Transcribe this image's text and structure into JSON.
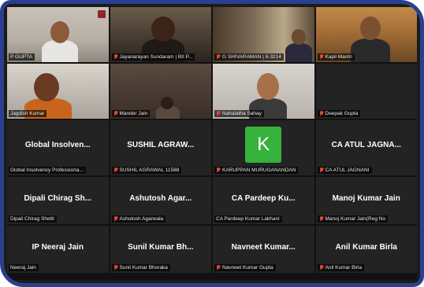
{
  "participants": [
    {
      "name": "P GUPTA",
      "muted": false,
      "kind": "video"
    },
    {
      "name": "Jayanarayan Sundaram | BII P...",
      "muted": true,
      "kind": "video"
    },
    {
      "name": "G SHIVARAMAN | 8-3214",
      "muted": true,
      "kind": "video"
    },
    {
      "name": "Kapil Mantri",
      "muted": true,
      "kind": "video",
      "active": true
    },
    {
      "name": "Jagdish Kumar",
      "muted": false,
      "kind": "video"
    },
    {
      "name": "Mander Jain",
      "muted": true,
      "kind": "video"
    },
    {
      "name": "Nahalatha Sahay",
      "muted": true,
      "kind": "video"
    },
    {
      "name": "Deepak Gupta",
      "muted": true,
      "kind": "empty"
    },
    {
      "display": "Global Insolven...",
      "name": "Global Insolvency Professiona...",
      "muted": false,
      "kind": "name"
    },
    {
      "display": "SUSHIL AGRAW...",
      "name": "SUSHIL AGRAWAL 11588",
      "muted": true,
      "kind": "name"
    },
    {
      "display": "K",
      "name": "KARUPPAN MURUGANANDAN",
      "muted": true,
      "kind": "avatar"
    },
    {
      "display": "CA ATUL JAGNA...",
      "name": "CA ATUL JAGNANI",
      "muted": true,
      "kind": "name"
    },
    {
      "display": "Dipali Chirag Sh...",
      "name": "Dipali Chirag Shetti",
      "muted": false,
      "kind": "name"
    },
    {
      "display": "Ashutosh Agar...",
      "name": "Ashutosh Agarwala",
      "muted": true,
      "kind": "name"
    },
    {
      "display": "CA Pardeep Ku...",
      "name": "CA Pardeep Kumar Lakhani",
      "muted": false,
      "kind": "name"
    },
    {
      "display": "Manoj Kumar Jain",
      "name": "Manoj Kumar Jain(Reg No",
      "muted": true,
      "kind": "name"
    },
    {
      "display": "IP Neeraj Jain",
      "name": "Neeraj Jain",
      "muted": false,
      "kind": "name"
    },
    {
      "display": "Sunil Kumar Bh...",
      "name": "Sunil Kumar Bhoraka",
      "muted": true,
      "kind": "name"
    },
    {
      "display": "Navneet Kumar...",
      "name": "Navneet Kumar Gupta",
      "muted": true,
      "kind": "name"
    },
    {
      "display": "Anil Kumar Birla",
      "name": "Anil Kumar Birla",
      "muted": true,
      "kind": "name"
    }
  ],
  "colors": {
    "frame": "#2b3f8f",
    "active_speaker": "#3fae2a",
    "avatar": "#36b23d",
    "mic_off": "#e0443a"
  }
}
